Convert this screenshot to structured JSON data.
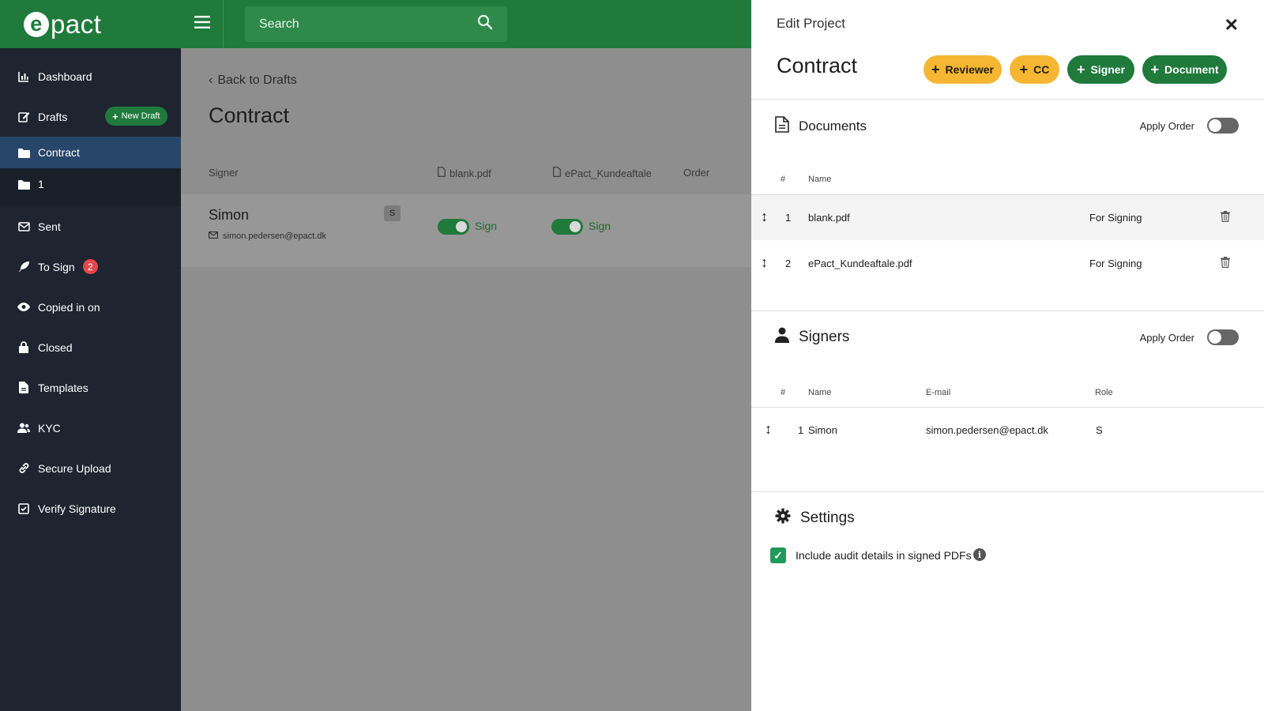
{
  "app": {
    "logo_e": "e",
    "logo_rest": "pact"
  },
  "sidebar": {
    "items": [
      {
        "label": "Dashboard"
      },
      {
        "label": "Drafts",
        "action": "New Draft"
      },
      {
        "label": "Contract"
      },
      {
        "label": "1"
      },
      {
        "label": "Sent"
      },
      {
        "label": "To Sign",
        "badge": "2"
      },
      {
        "label": "Copied in on"
      },
      {
        "label": "Closed"
      },
      {
        "label": "Templates"
      },
      {
        "label": "KYC"
      },
      {
        "label": "Secure Upload"
      },
      {
        "label": "Verify Signature"
      }
    ]
  },
  "topbar": {
    "search_placeholder": "Search"
  },
  "main": {
    "back": "Back to Drafts",
    "title": "Contract",
    "columns": {
      "signer": "Signer",
      "doc1": "blank.pdf",
      "doc2": "ePact_Kundeaftale",
      "order": "Order"
    },
    "signer": {
      "name": "Simon",
      "email": "simon.pedersen@epact.dk",
      "role": "S",
      "sign1": "Sign",
      "sign2": "Sign"
    }
  },
  "panel": {
    "header": "Edit Project",
    "title": "Contract",
    "buttons": {
      "reviewer": "Reviewer",
      "cc": "CC",
      "signer": "Signer",
      "document": "Document"
    },
    "documents": {
      "title": "Documents",
      "apply_order": "Apply Order",
      "col_num": "#",
      "col_name": "Name",
      "rows": [
        {
          "num": "1",
          "name": "blank.pdf",
          "status": "For Signing"
        },
        {
          "num": "2",
          "name": "ePact_Kundeaftale.pdf",
          "status": "For Signing"
        }
      ]
    },
    "signers": {
      "title": "Signers",
      "apply_order": "Apply Order",
      "col_num": "#",
      "col_name": "Name",
      "col_email": "E-mail",
      "col_role": "Role",
      "rows": [
        {
          "num": "1",
          "name": "Simon",
          "email": "simon.pedersen@epact.dk",
          "role": "S"
        }
      ]
    },
    "settings": {
      "title": "Settings",
      "audit_label": "Include audit details in signed PDFs"
    }
  },
  "colors": {
    "brand_green": "#1f7a3c",
    "sidebar_bg": "#1e2531",
    "accent_yellow": "#f5b731",
    "badge_red": "#e5484d"
  }
}
